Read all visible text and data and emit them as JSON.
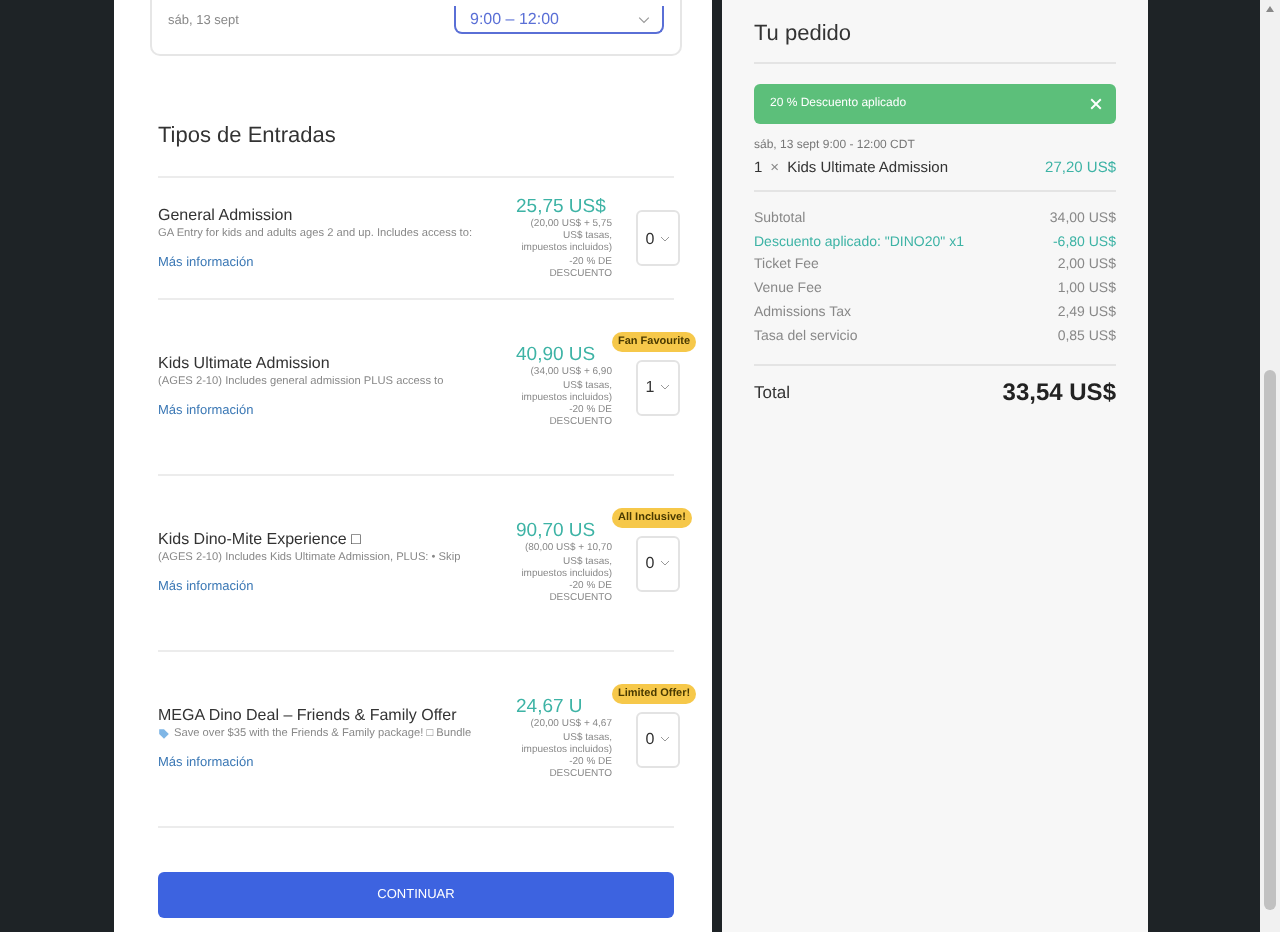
{
  "time_card": {
    "date": "sáb, 13 sept",
    "time_select": "9:00 – 12:00"
  },
  "tickets": {
    "title": "Tipos de Entradas",
    "items": [
      {
        "name": "General Admission",
        "description": "GA Entry for kids and adults ages 2 and up. Includes access to:",
        "link": "Más información",
        "price": "25,75 US$",
        "price_note": "(20,00 US$ + 5,75 US$ tasas, impuestos incluidos) -20 % DE DESCUENTO",
        "quantity": "0"
      },
      {
        "name": "Kids Ultimate Admission",
        "description": "(AGES 2-10) Includes general admission PLUS access to",
        "link": "Más información",
        "price": "40,90 US",
        "badge": "Fan Favourite",
        "price_note": "(34,00 US$ + 6,90 US$ tasas, impuestos incluidos) -20 % DE DESCUENTO",
        "quantity": "1"
      },
      {
        "name": "Kids Dino-Mite Experience □",
        "description": "(AGES 2-10) Includes Kids Ultimate Admission, PLUS: • Skip",
        "link": "Más información",
        "price": "90,70 US",
        "badge": "All Inclusive!",
        "price_note": "(80,00 US$ + 10,70 US$ tasas, impuestos incluidos) -20 % DE DESCUENTO",
        "quantity": "0"
      },
      {
        "name": "MEGA Dino Deal – Friends & Family Offer",
        "description": "Save over $35 with the Friends & Family package! □ Bundle",
        "tag_icon": true,
        "link": "Más información",
        "price": "24,67 U",
        "badge": "Limited Offer!",
        "price_note": "(20,00 US$ + 4,67 US$ tasas, impuestos incluidos) -20 % DE DESCUENTO",
        "quantity": "0"
      }
    ]
  },
  "continue_button": "CONTINUAR",
  "order": {
    "title": "Tu pedido",
    "discount_banner": "20 % Descuento aplicado",
    "date_line": "sáb, 13 sept 9:00 - 12:00 CDT",
    "line_item": {
      "quantity": "1",
      "times": "×",
      "name": "Kids Ultimate Admission",
      "price": "27,20 US$"
    },
    "rows": [
      {
        "label": "Subtotal",
        "value": "34,00 US$",
        "kind": "normal"
      },
      {
        "label": "Descuento aplicado: \"DINO20\" x1",
        "value": "-6,80 US$",
        "kind": "discount"
      },
      {
        "label": "Ticket Fee",
        "value": "2,00 US$",
        "kind": "normal"
      },
      {
        "label": "Venue Fee",
        "value": "1,00 US$",
        "kind": "normal"
      },
      {
        "label": "Admissions Tax",
        "value": "2,49 US$",
        "kind": "normal"
      },
      {
        "label": "Tasa del servicio",
        "value": "0,85 US$",
        "kind": "normal"
      }
    ],
    "total": {
      "label": "Total",
      "value": "33,54 US$"
    }
  }
}
